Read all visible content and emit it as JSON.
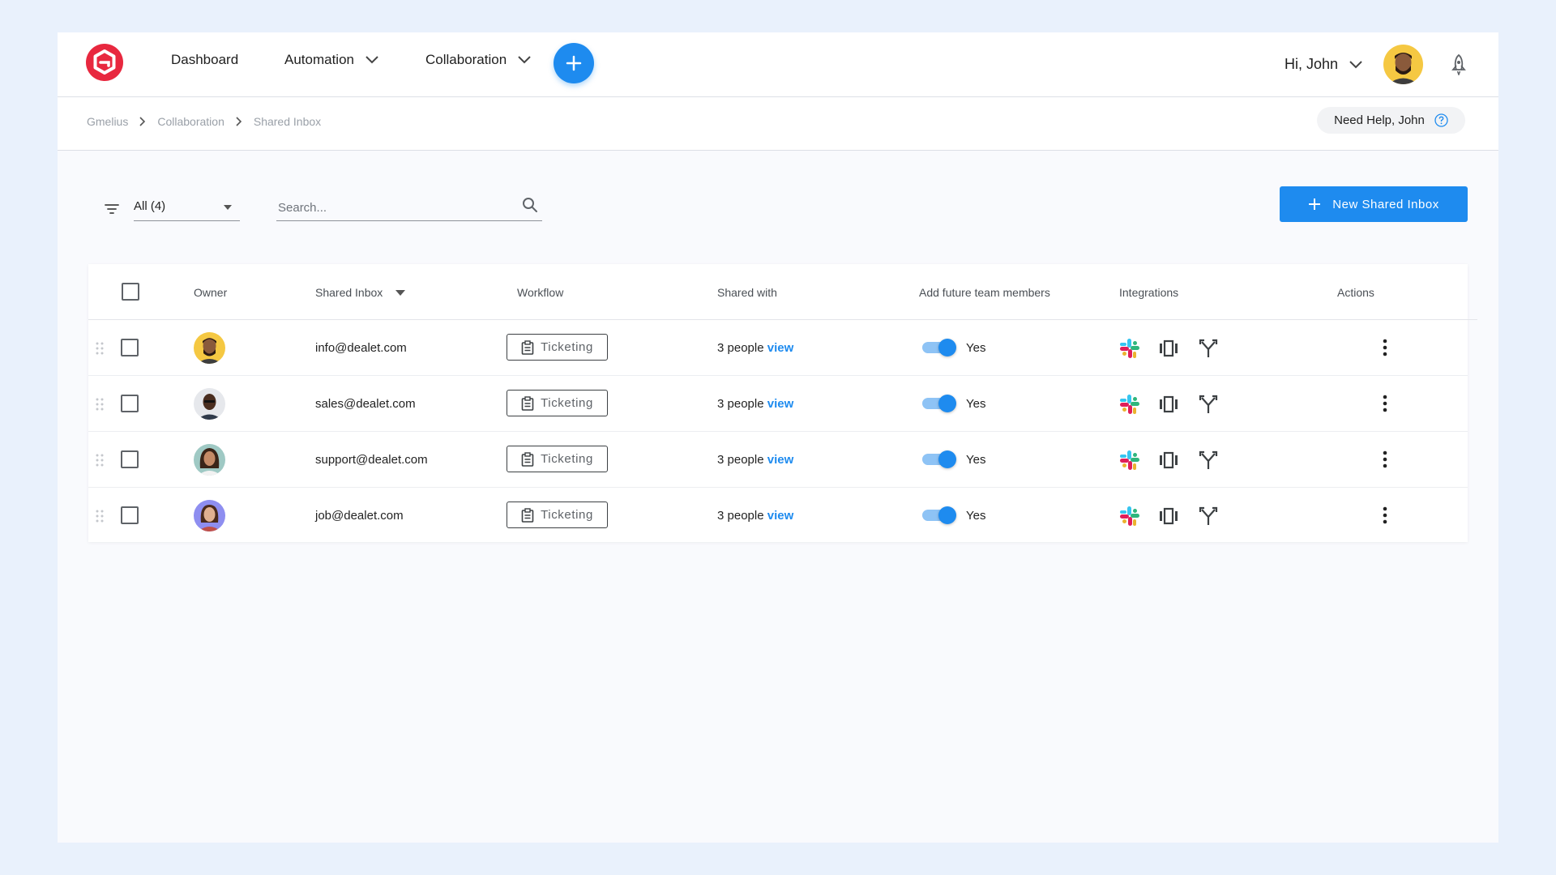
{
  "nav": {
    "dashboard": "Dashboard",
    "automation": "Automation",
    "collaboration": "Collaboration",
    "greeting": "Hi, John"
  },
  "breadcrumb": [
    "Gmelius",
    "Collaboration",
    "Shared Inbox"
  ],
  "help": {
    "label": "Need Help, John"
  },
  "filter": {
    "selected": "All (4)"
  },
  "search": {
    "placeholder": "Search..."
  },
  "new_button": {
    "label": "New Shared Inbox"
  },
  "table": {
    "headers": {
      "owner": "Owner",
      "shared_inbox": "Shared Inbox",
      "workflow": "Workflow",
      "shared_with": "Shared with",
      "add_future": "Add future team members",
      "integrations": "Integrations",
      "actions": "Actions"
    },
    "rows": [
      {
        "email": "info@dealet.com",
        "workflow": "Ticketing",
        "shared_count": "3 people",
        "view": "view",
        "add_future": "Yes"
      },
      {
        "email": "sales@dealet.com",
        "workflow": "Ticketing",
        "shared_count": "3 people",
        "view": "view",
        "add_future": "Yes"
      },
      {
        "email": "support@dealet.com",
        "workflow": "Ticketing",
        "shared_count": "3 people",
        "view": "view",
        "add_future": "Yes"
      },
      {
        "email": "job@dealet.com",
        "workflow": "Ticketing",
        "shared_count": "3 people",
        "view": "view",
        "add_future": "Yes"
      }
    ]
  },
  "colors": {
    "accent": "#1e8bef",
    "logo": "#e8283f",
    "background": "#e9f1fc"
  }
}
